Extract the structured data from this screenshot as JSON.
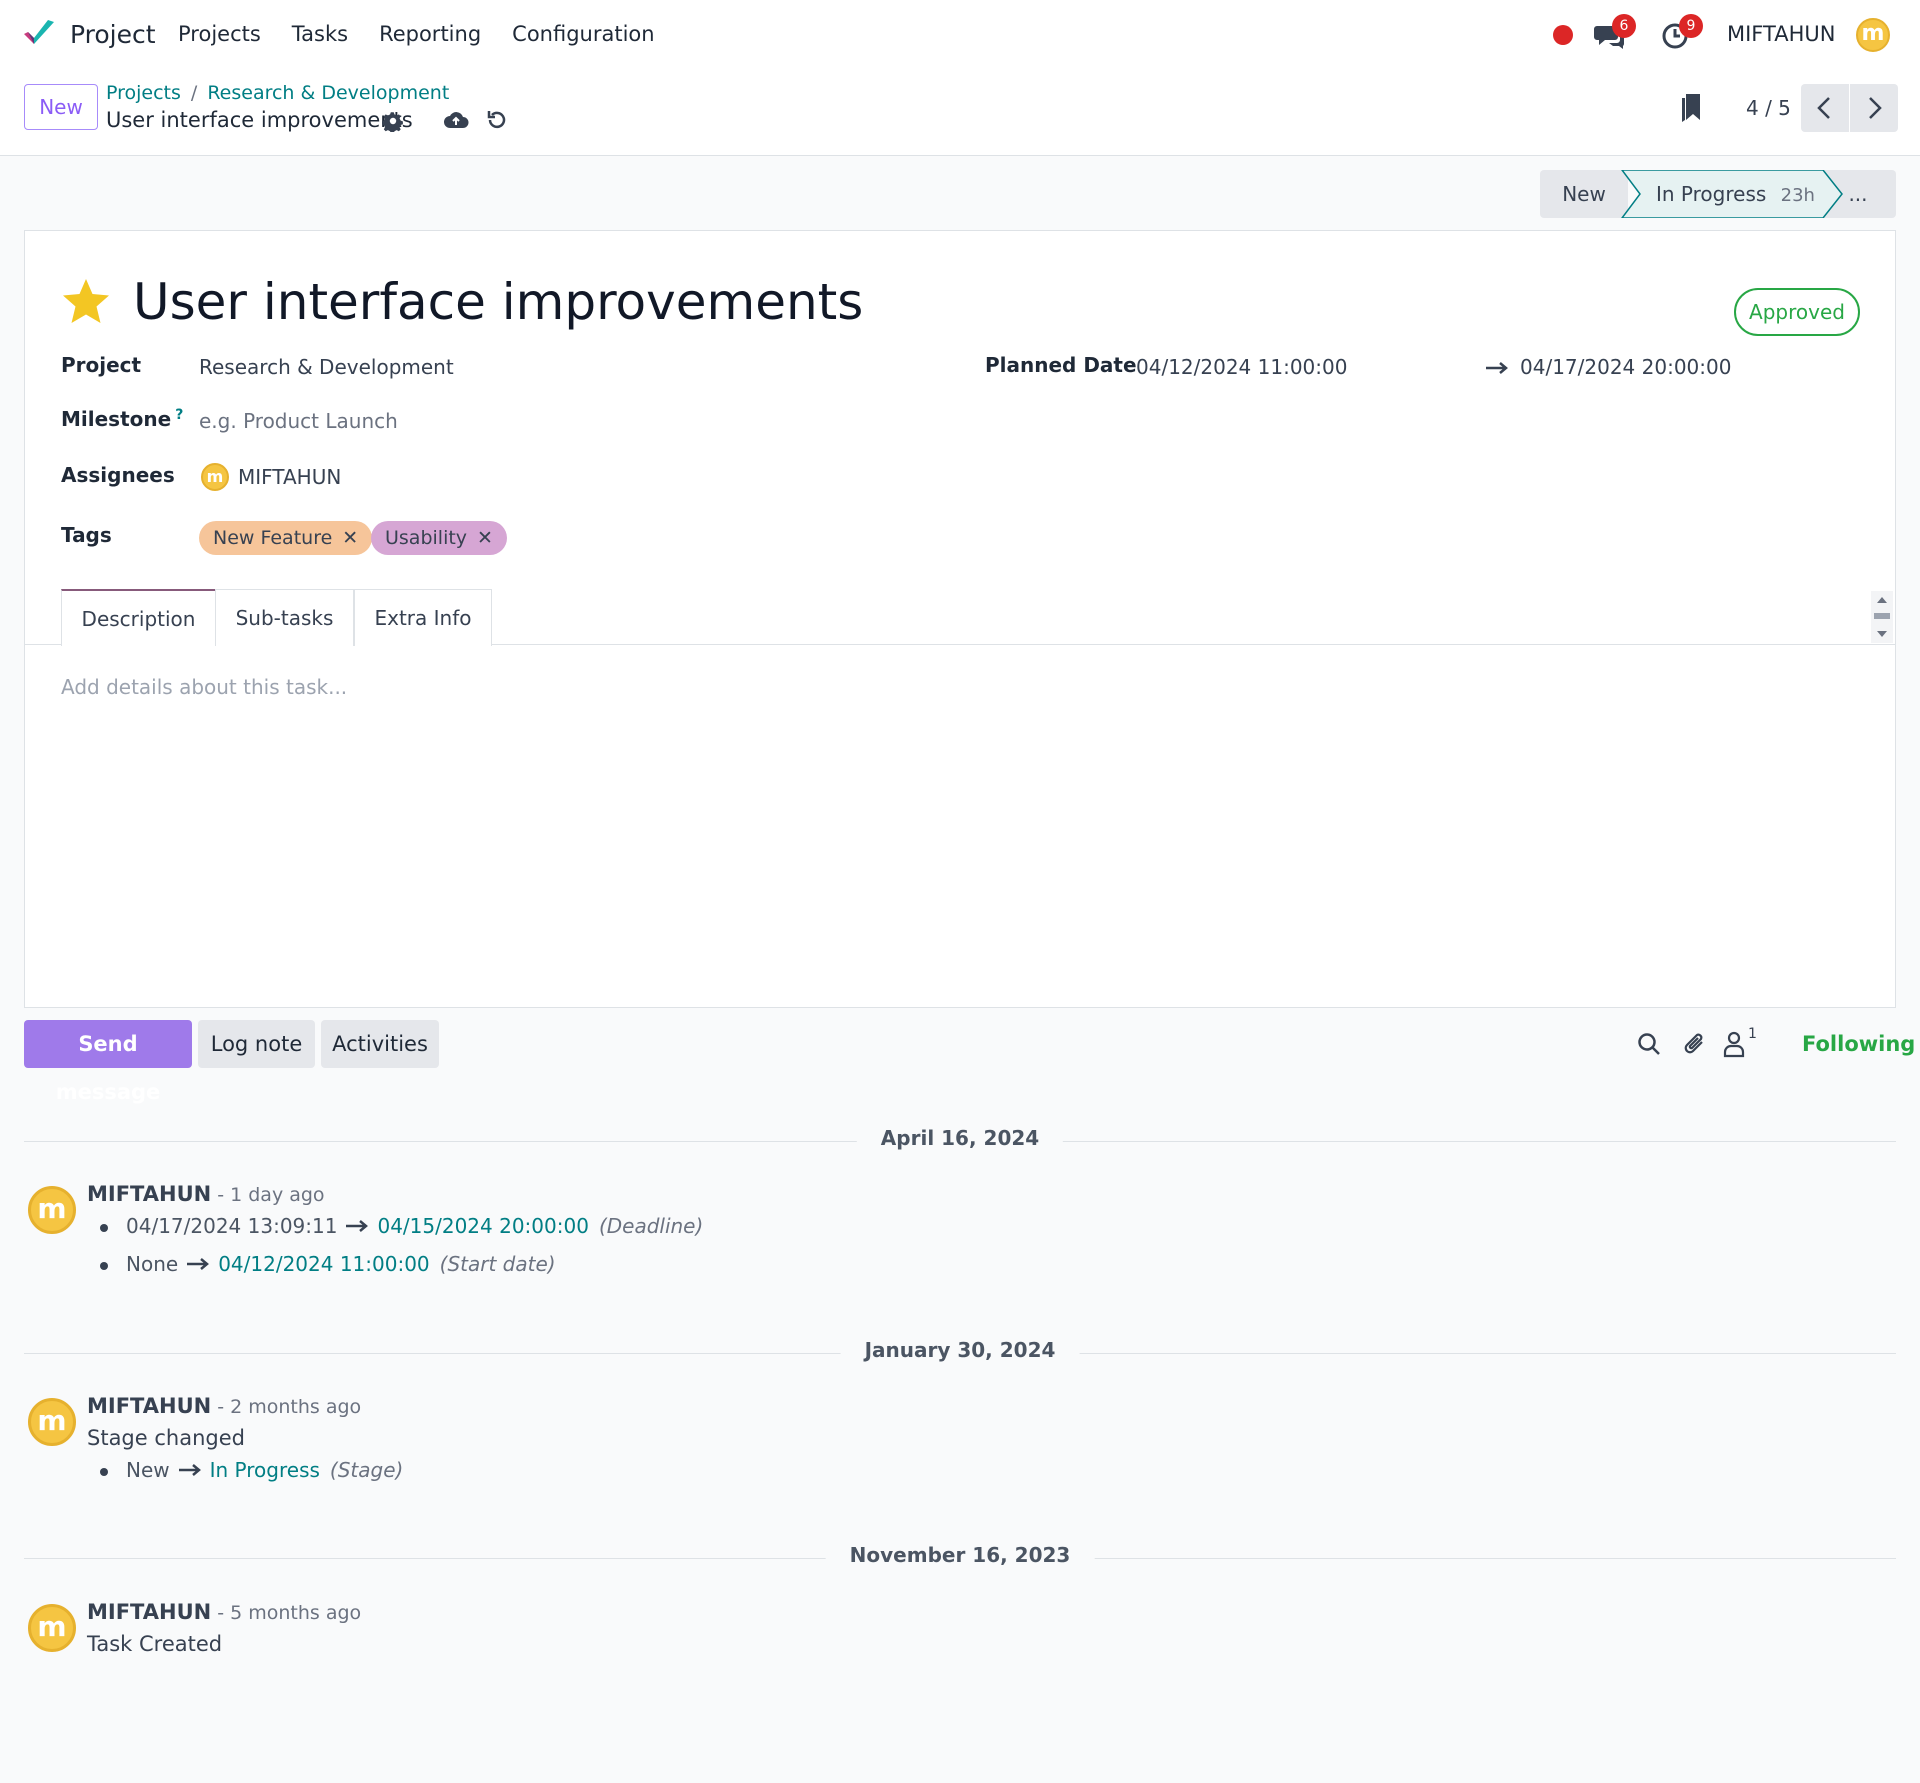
{
  "nav": {
    "app_name": "Project",
    "menu": [
      "Projects",
      "Tasks",
      "Reporting",
      "Configuration"
    ],
    "messages_count": "6",
    "activities_count": "9",
    "user": "MIFTAHUN",
    "avatar_letter": "m"
  },
  "control": {
    "new_label": "New",
    "breadcrumb": [
      "Projects",
      "Research & Development"
    ],
    "breadcrumb_sep": "/",
    "record_name": "User interface improvements",
    "pager": "4 / 5"
  },
  "status": {
    "stages": [
      "New",
      "In Progress",
      "..."
    ],
    "active_time": "23h"
  },
  "form": {
    "title": "User interface improvements",
    "state_badge": "Approved",
    "project_label": "Project",
    "project_value": "Research & Development",
    "milestone_label": "Milestone",
    "milestone_help": "?",
    "milestone_placeholder": "e.g. Product Launch",
    "assignees_label": "Assignees",
    "assignee": "MIFTAHUN",
    "tags_label": "Tags",
    "tags": [
      "New Feature",
      "Usability"
    ],
    "planned_label": "Planned Date",
    "planned_start": "04/12/2024 11:00:00",
    "planned_end": "04/17/2024 20:00:00",
    "tabs": [
      "Description",
      "Sub-tasks",
      "Extra Info"
    ],
    "description_placeholder": "Add details about this task..."
  },
  "chatter": {
    "send_label": "Send message",
    "log_label": "Log note",
    "activities_label": "Activities",
    "followers_count": "1",
    "following_label": "Following",
    "groups": [
      {
        "date": "April 16, 2024",
        "author": "MIFTAHUN",
        "ago": "- 1 day ago",
        "changes": [
          {
            "from": "04/17/2024 13:09:11",
            "to": "04/15/2024 20:00:00",
            "field": "(Deadline)"
          },
          {
            "from": "None",
            "to": "04/12/2024 11:00:00",
            "field": "(Start date)"
          }
        ]
      },
      {
        "date": "January 30, 2024",
        "author": "MIFTAHUN",
        "ago": "- 2 months ago",
        "body": "Stage changed",
        "changes": [
          {
            "from": "New",
            "to": "In Progress",
            "field": "(Stage)"
          }
        ]
      },
      {
        "date": "November 16, 2023",
        "author": "MIFTAHUN",
        "ago": "- 5 months ago",
        "body": "Task Created"
      }
    ]
  },
  "colors": {
    "accent_teal": "#017e84",
    "primary_purple": "#9f7aea",
    "success_green": "#28a745",
    "badge_red": "#dc2626"
  }
}
